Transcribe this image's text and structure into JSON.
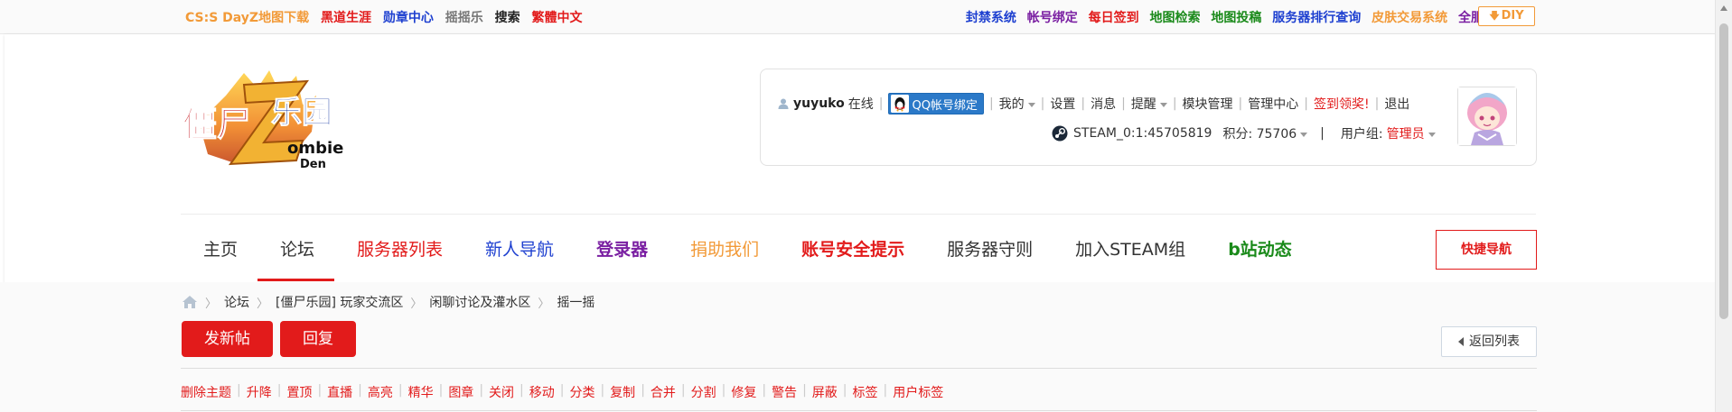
{
  "topbar": {
    "left_links": [
      {
        "label": "CS:S DayZ地图下载",
        "color": "#f29a38"
      },
      {
        "label": "黑道生涯",
        "color": "#e21b1b"
      },
      {
        "label": "勋章中心",
        "color": "#1e40d0"
      },
      {
        "label": "摇摇乐",
        "color": "#777777"
      },
      {
        "label": "搜索",
        "color": "#222222"
      },
      {
        "label": "繁體中文",
        "color": "#e21b1b"
      }
    ],
    "right_links": [
      {
        "label": "封禁系统",
        "color": "#1e40d0"
      },
      {
        "label": "帐号绑定",
        "color": "#7a1fa2"
      },
      {
        "label": "每日签到",
        "color": "#e21b1b"
      },
      {
        "label": "地图检索",
        "color": "#1a8a1a"
      },
      {
        "label": "地图投稿",
        "color": "#1a8a1a"
      },
      {
        "label": "服务器排行查询",
        "color": "#1e40d0"
      },
      {
        "label": "皮肤交易系统",
        "color": "#f29a38"
      },
      {
        "label": "全服资源下载",
        "color": "#7a1fa2"
      }
    ],
    "diy_label": "DIY"
  },
  "logo": {
    "alt": "僵尸乐园 Zombie Den"
  },
  "user_panel": {
    "username": "yuyuko",
    "online": "在线",
    "qq_bind": "QQ帐号绑定",
    "my": "我的",
    "settings": "设置",
    "messages": "消息",
    "remind": "提醒",
    "module_manage": "模块管理",
    "admin_center": "管理中心",
    "checkin": "签到领奖!",
    "logout": "退出",
    "steam_id": "STEAM_0:1:45705819",
    "points_label": "积分: 75706",
    "usergroup_label": "用户组:",
    "usergroup_value": "管理员"
  },
  "nav": {
    "items": [
      {
        "label": "主页",
        "color": "#333333",
        "bold": false
      },
      {
        "label": "论坛",
        "color": "#333333",
        "bold": false,
        "active": true
      },
      {
        "label": "服务器列表",
        "color": "#e21b1b",
        "bold": false
      },
      {
        "label": "新人导航",
        "color": "#1e40d0",
        "bold": false
      },
      {
        "label": "登录器",
        "color": "#7a1fa2",
        "bold": true
      },
      {
        "label": "捐助我们",
        "color": "#f29a38",
        "bold": false
      },
      {
        "label": "账号安全提示",
        "color": "#e21b1b",
        "bold": true
      },
      {
        "label": "服务器守则",
        "color": "#333333",
        "bold": false
      },
      {
        "label": "加入STEAM组",
        "color": "#333333",
        "bold": false
      },
      {
        "label": "b站动态",
        "color": "#1a8a1a",
        "bold": true
      }
    ],
    "quick_nav": "快捷导航"
  },
  "breadcrumb": {
    "items": [
      "论坛",
      "[僵尸乐园] 玩家交流区",
      "闲聊讨论及灌水区",
      "摇一摇"
    ]
  },
  "actions": {
    "new_post": "发新帖",
    "reply": "回复",
    "back_to_list": "返回列表"
  },
  "mod_actions": [
    "删除主题",
    "升降",
    "置顶",
    "直播",
    "高亮",
    "精华",
    "图章",
    "关闭",
    "移动",
    "分类",
    "复制",
    "合并",
    "分割",
    "修复",
    "警告",
    "屏蔽",
    "标签",
    "用户标签"
  ]
}
